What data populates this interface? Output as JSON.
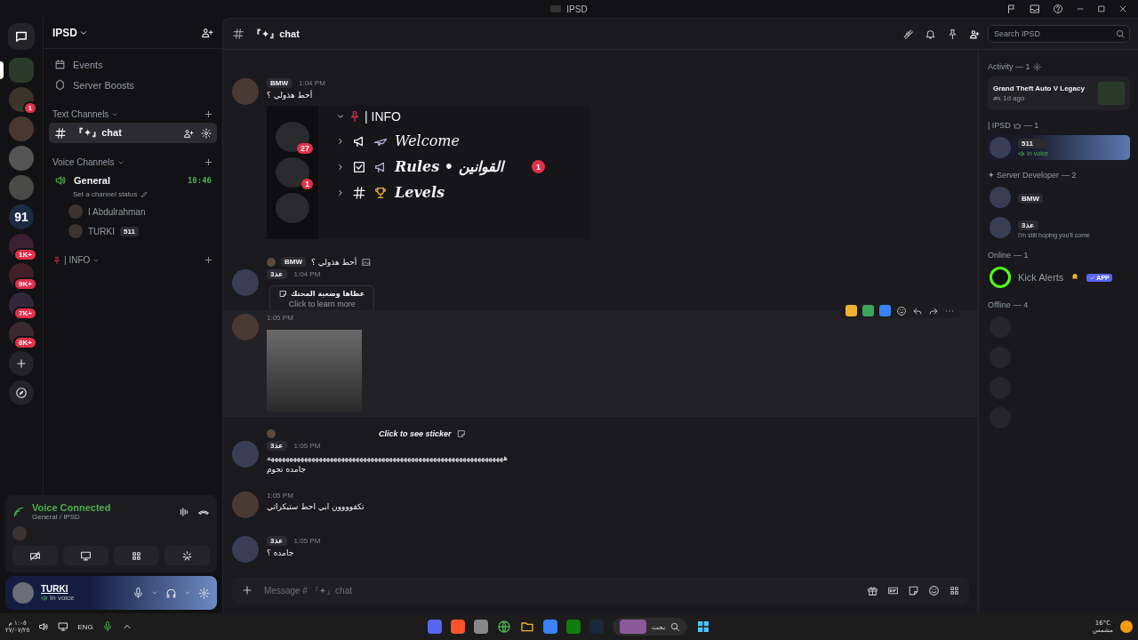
{
  "window": {
    "title": "IPSD"
  },
  "servers": [
    {
      "selected": true
    },
    {
      "selected": false,
      "badge": "1"
    },
    {
      "selected": false
    },
    {
      "selected": false
    },
    {
      "selected": false
    },
    {
      "selected": false,
      "label": "91"
    },
    {
      "selected": false,
      "badge": "1K+"
    },
    {
      "selected": false,
      "badge": "9K+"
    },
    {
      "selected": false,
      "badge": "7K+"
    },
    {
      "selected": false,
      "badge": "8K+"
    }
  ],
  "sidebar": {
    "server_name": "IPSD",
    "menu": [
      "Events",
      "Server Boosts"
    ],
    "categories": [
      {
        "name": "Text Channels",
        "channels": [
          {
            "kind": "text",
            "name": "『✦』chat",
            "selected": true
          }
        ]
      },
      {
        "name": "Voice Channels",
        "channels": [
          {
            "kind": "voice",
            "name": "General",
            "selected": false,
            "timer": "10:46",
            "status": "Set a channel status",
            "members": [
              {
                "name": "I Abdulrahman"
              },
              {
                "name": "TURKI",
                "tag": "511"
              }
            ]
          }
        ]
      },
      {
        "name": "| INFO"
      }
    ]
  },
  "voice_panel": {
    "title": "Voice Connected",
    "subtitle": "General / IPSD"
  },
  "user_panel": {
    "name": "TURKI",
    "status": "In voice"
  },
  "chat": {
    "channel": "『✦』chat",
    "search_placeholder": "Search IPSD",
    "input_placeholder": "Message # 『✦』chat",
    "messages": [
      {
        "kind": "screenshot",
        "badge": "BMW",
        "time": "1:04 PM",
        "text": "أحط هذولي ؟",
        "shot": {
          "category": "| INFO",
          "server_badges": [
            "27",
            "1"
          ],
          "rows": [
            {
              "label": "Welcome"
            },
            {
              "label": "Rules • القوانين",
              "badge": "1"
            },
            {
              "label": "Levels"
            }
          ]
        }
      },
      {
        "kind": "tooltip",
        "reply": {
          "badge": "BMW",
          "text": "أحط هذولي ؟"
        },
        "badge": "عذ3",
        "time": "1:04 PM",
        "tooltip": {
          "title": "عطاها وضعية المحتك",
          "hint": "Click to learn more"
        }
      },
      {
        "kind": "image",
        "time": "1:05 PM",
        "highlighted": true
      },
      {
        "kind": "text",
        "reply": {
          "text": "Click to see sticker"
        },
        "badge": "عذ3",
        "time": "1:05 PM",
        "lines": [
          "ههههههههههههههههههههههههههههههههههههههههههههههههههههههههههههههههه",
          "جامده تحوم"
        ]
      },
      {
        "kind": "text",
        "time": "1:05 PM",
        "lines": [
          "تكفوووون ابي احط ستيكراتي"
        ]
      },
      {
        "kind": "text",
        "badge": "عذ3",
        "time": "1:05 PM",
        "lines": [
          "جامده ؟"
        ]
      }
    ]
  },
  "members": {
    "sections": [
      {
        "kind": "activity",
        "title": "Activity — 1",
        "game": "Grand Theft Auto V Legacy",
        "ago": "1d ago"
      },
      {
        "kind": "owner",
        "title": "| IPSD",
        "count": "— 1",
        "people": [
          {
            "kind": "banner",
            "tag": "511",
            "status": "In voice"
          }
        ]
      },
      {
        "kind": "role",
        "title": "✦ Server Developer",
        "count": "— 2",
        "people": [
          {
            "kind": "badge",
            "tag": "BMW"
          },
          {
            "kind": "badge",
            "tag": "عذ3",
            "status": "I'm still hoping you'll come"
          }
        ]
      },
      {
        "kind": "role",
        "title": "Online",
        "count": "— 1",
        "people": [
          {
            "kind": "app",
            "name": "Kick Alerts",
            "tag": "APP"
          }
        ]
      },
      {
        "kind": "offline",
        "title": "Offline",
        "count": "— 4",
        "people": [
          {
            "kind": "offline"
          },
          {
            "kind": "offline"
          },
          {
            "kind": "offline"
          },
          {
            "kind": "offline"
          }
        ]
      }
    ]
  },
  "taskbar": {
    "time": "١:٠٥ م",
    "date": "٢٧/٠٧/٢٥",
    "language": "ENG",
    "search": "بحث",
    "temperature": "16°C",
    "weather": "مشمس"
  }
}
